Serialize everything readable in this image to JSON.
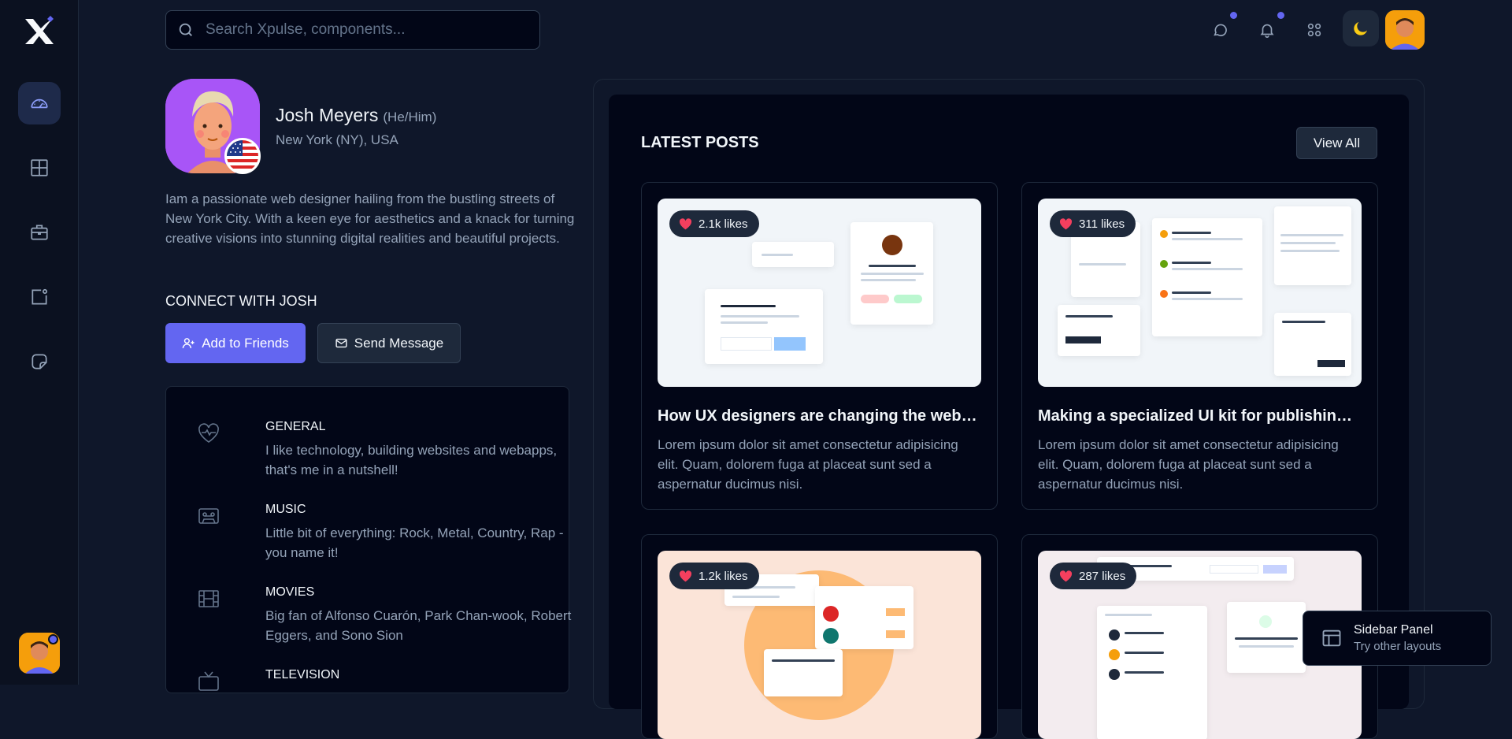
{
  "brand": {
    "logo_icon": "x-logo-icon"
  },
  "sidebar": {
    "items": [
      {
        "name": "dashboard",
        "icon": "gauge-icon",
        "active": true
      },
      {
        "name": "layouts",
        "icon": "grid-icon",
        "active": false
      },
      {
        "name": "briefcase",
        "icon": "briefcase-icon",
        "active": false
      },
      {
        "name": "notification",
        "icon": "square-dot-icon",
        "active": false
      },
      {
        "name": "notes",
        "icon": "sticky-note-icon",
        "active": false
      }
    ]
  },
  "header": {
    "search_placeholder": "Search Xpulse, components...",
    "icons": [
      "chat-icon",
      "bell-icon",
      "apps-grid-icon",
      "moon-icon"
    ]
  },
  "profile": {
    "name": "Josh Meyers",
    "pronouns": "(He/Him)",
    "location": "New York (NY), USA",
    "bio": "Iam a passionate web designer hailing from the bustling streets of New York City. With a keen eye for aesthetics and a knack for turning creative visions into stunning digital realities and beautiful projects.",
    "connect_heading": "CONNECT WITH JOSH",
    "add_friend_label": "Add to Friends",
    "send_message_label": "Send Message",
    "interests": [
      {
        "icon": "heart-pulse-icon",
        "title": "GENERAL",
        "text": "I like technology, building websites and webapps, that's me in a nutshell!"
      },
      {
        "icon": "cassette-icon",
        "title": "MUSIC",
        "text": "Little bit of everything: Rock, Metal, Country, Rap - you name it!"
      },
      {
        "icon": "film-icon",
        "title": "MOVIES",
        "text": "Big fan of Alfonso Cuarón, Park Chan-wook, Robert Eggers, and Sono Sion"
      },
      {
        "icon": "tv-icon",
        "title": "TELEVISION",
        "text": ""
      }
    ]
  },
  "posts": {
    "heading": "LATEST POSTS",
    "view_all_label": "View All",
    "items": [
      {
        "likes": "2.1k likes",
        "title": "How UX designers are changing the web…",
        "desc": "Lorem ipsum dolor sit amet consectetur adipisicing elit. Quam, dolorem fuga at placeat sunt sed a aspernatur ducimus nisi."
      },
      {
        "likes": "311 likes",
        "title": "Making a specialized UI kit for publishing an…",
        "desc": "Lorem ipsum dolor sit amet consectetur adipisicing elit. Quam, dolorem fuga at placeat sunt sed a aspernatur ducimus nisi."
      },
      {
        "likes": "1.2k likes",
        "title": "",
        "desc": ""
      },
      {
        "likes": "287 likes",
        "title": "",
        "desc": ""
      }
    ]
  },
  "sidebar_panel": {
    "title": "Sidebar Panel",
    "subtitle": "Try other layouts"
  },
  "colors": {
    "accent": "#6366f1",
    "background": "#0f172a",
    "card": "#020617",
    "heart": "#f43f5e",
    "moon": "#facc15"
  }
}
